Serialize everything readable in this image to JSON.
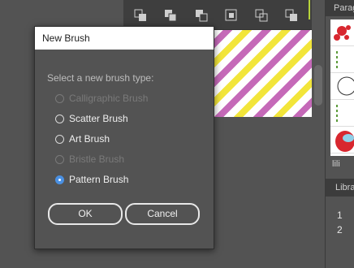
{
  "toolbar": {
    "icons": [
      "unite-icon",
      "minus-front-icon",
      "intersect-icon",
      "exclude-icon",
      "divide-icon",
      "trim-icon"
    ]
  },
  "panel": {
    "header": "Parag",
    "footer_label": "lili",
    "libraries_header": "Libra",
    "rows": [
      "1",
      "2"
    ]
  },
  "dialog": {
    "title": "New Brush",
    "prompt": "Select a new brush type:",
    "options": [
      {
        "label": "Calligraphic Brush",
        "enabled": false,
        "checked": false
      },
      {
        "label": "Scatter Brush",
        "enabled": true,
        "checked": false
      },
      {
        "label": "Art Brush",
        "enabled": true,
        "checked": false
      },
      {
        "label": "Bristle Brush",
        "enabled": false,
        "checked": false
      },
      {
        "label": "Pattern Brush",
        "enabled": true,
        "checked": true
      }
    ],
    "ok_label": "OK",
    "cancel_label": "Cancel"
  },
  "colors": {
    "stripe_pink": "#c569b8",
    "stripe_yellow": "#f2e53a",
    "radio_checked": "#4a90e2"
  }
}
